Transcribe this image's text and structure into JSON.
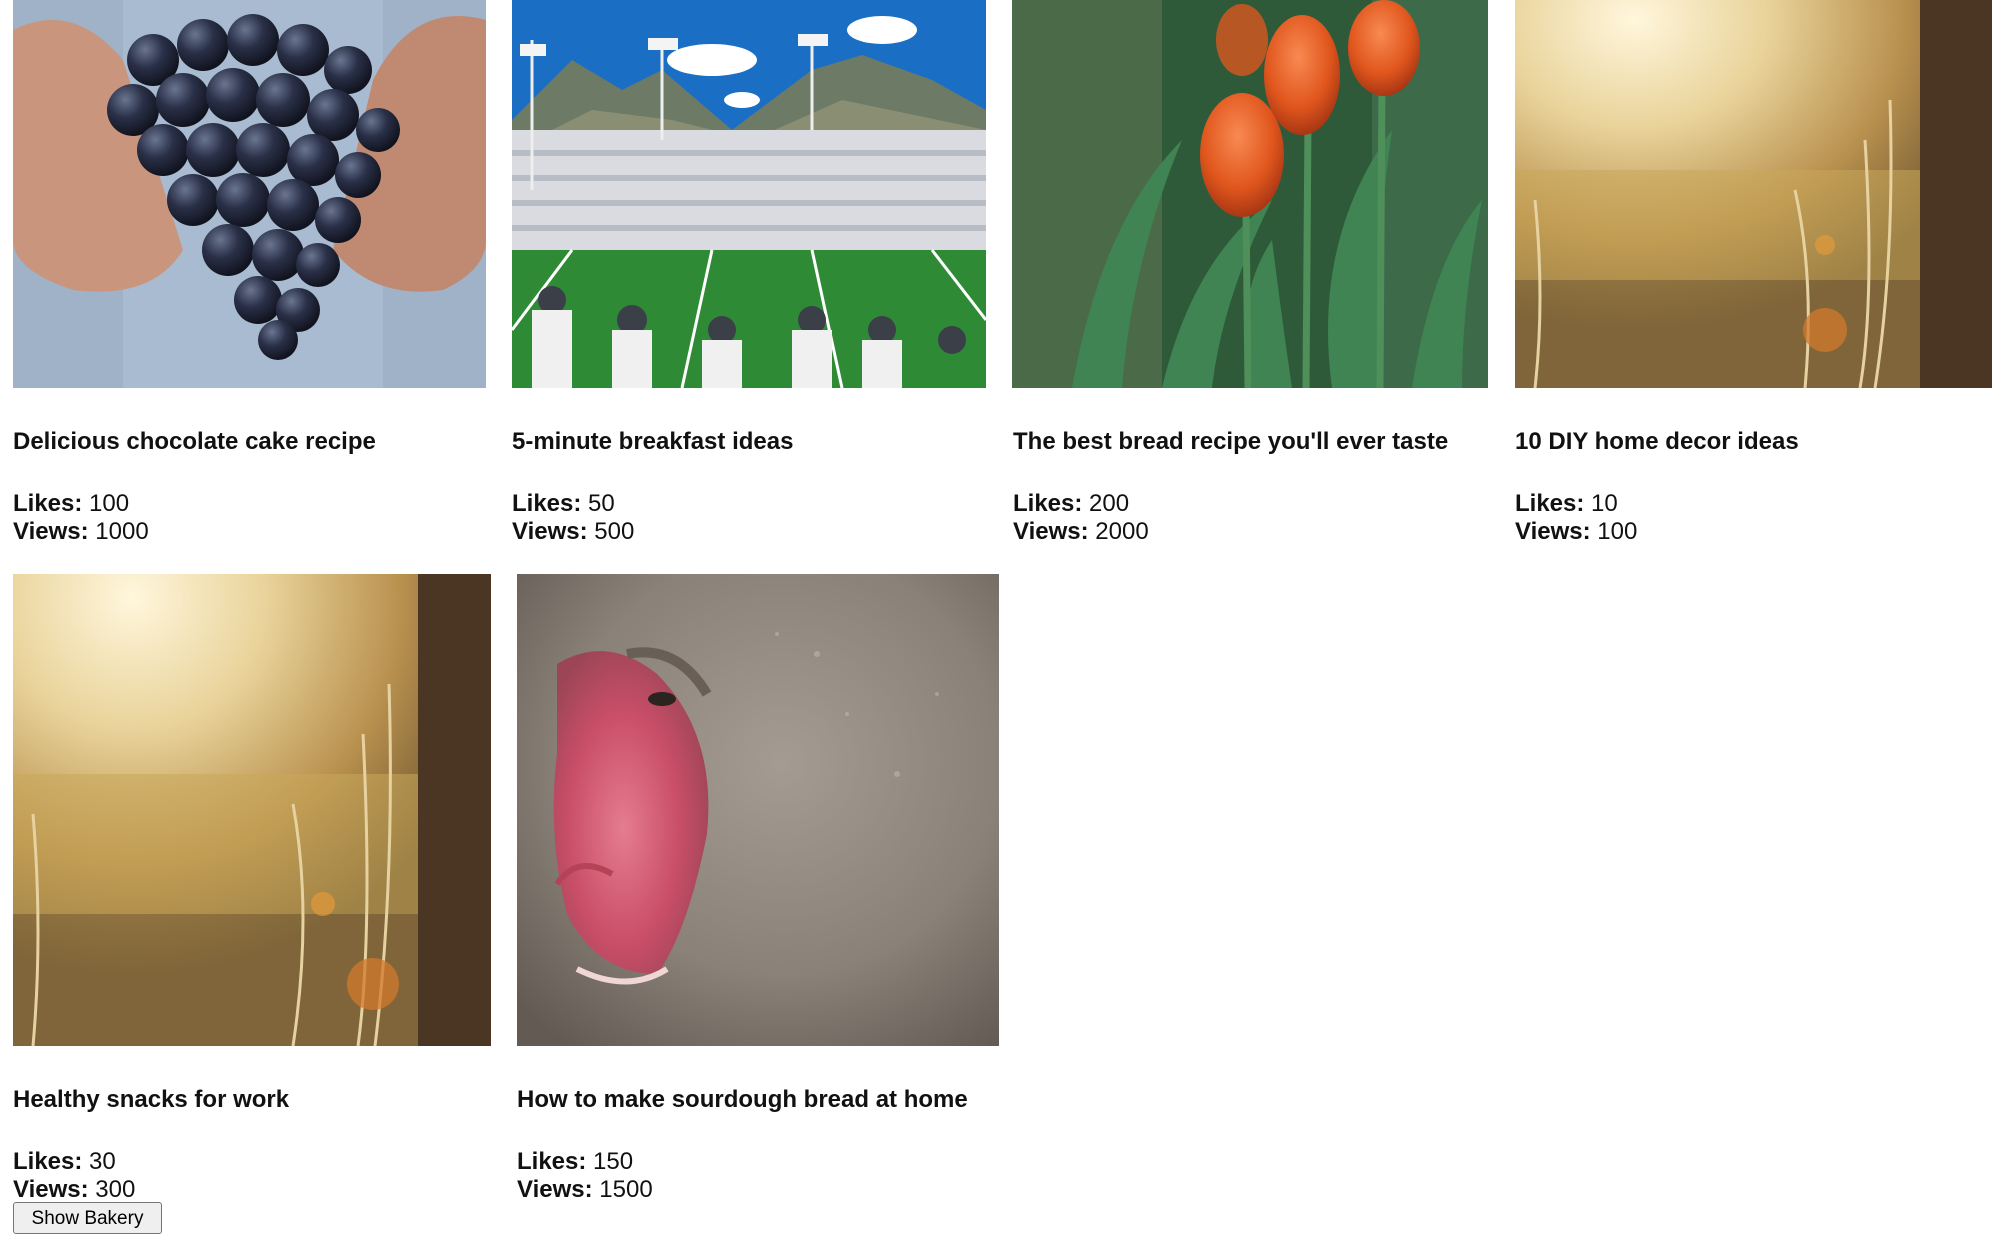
{
  "labels": {
    "likes": "Likes:",
    "views": "Views:"
  },
  "posts": [
    {
      "title": "Delicious chocolate cake recipe",
      "likes": "100",
      "views": "1000",
      "image": "grapes-in-hands"
    },
    {
      "title": "5-minute breakfast ideas",
      "likes": "50",
      "views": "500",
      "image": "stadium-mountains"
    },
    {
      "title": "The best bread recipe you'll ever taste",
      "likes": "200",
      "views": "2000",
      "image": "orange-tulips"
    },
    {
      "title": "10 DIY home decor ideas",
      "likes": "10",
      "views": "100",
      "image": "sunlit-grass"
    },
    {
      "title": "Healthy snacks for work",
      "likes": "30",
      "views": "300",
      "image": "sunlit-grass"
    },
    {
      "title": "How to make sourdough bread at home",
      "likes": "150",
      "views": "1500",
      "image": "snow-monkey"
    }
  ],
  "button": {
    "label": "Show Bakery"
  }
}
